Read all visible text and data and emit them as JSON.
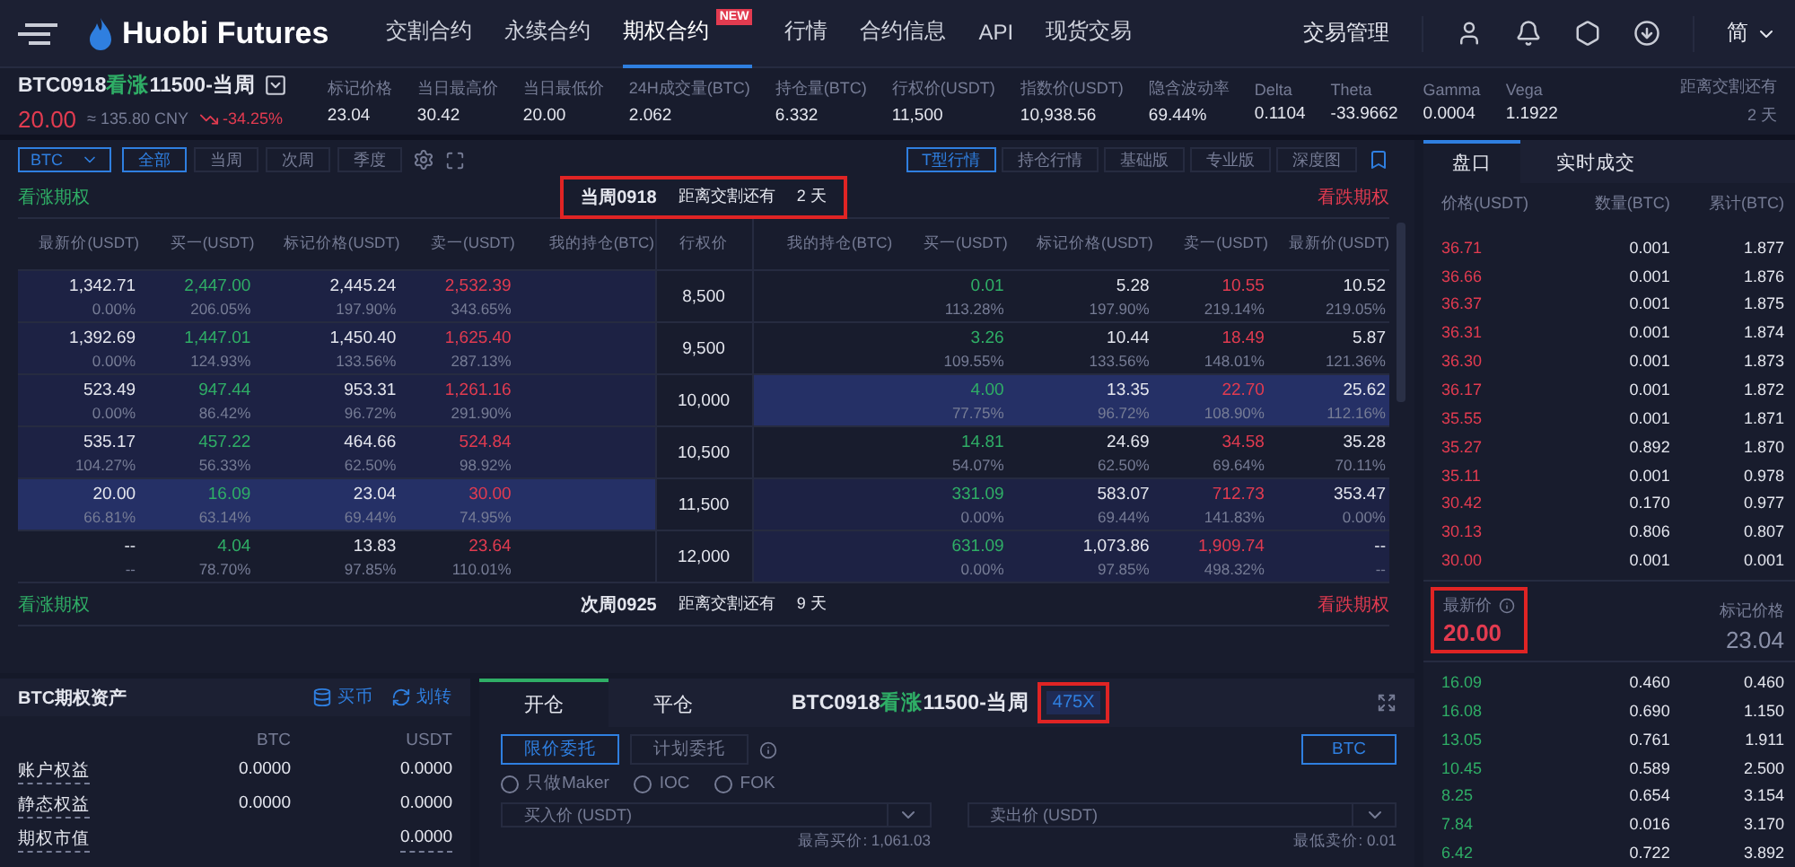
{
  "header": {
    "logo": "Huobi Futures",
    "nav": [
      {
        "label": "交割合约",
        "selected": false
      },
      {
        "label": "永续合约",
        "selected": false
      },
      {
        "label": "期权合约",
        "selected": true,
        "badge": "NEW"
      },
      {
        "label": "行情",
        "selected": false
      },
      {
        "label": "合约信息",
        "selected": false
      },
      {
        "label": "API",
        "selected": false
      },
      {
        "label": "现货交易",
        "selected": false
      }
    ],
    "manage": "交易管理",
    "language": "简"
  },
  "ticker": {
    "contract": {
      "code": "BTC0918",
      "side": "看涨",
      "detail": "11500-当周"
    },
    "price": "20.00",
    "cny": "≈ 135.80 CNY",
    "change": "-34.25%",
    "stats": [
      {
        "label": "标记价格",
        "value": "23.04"
      },
      {
        "label": "当日最高价",
        "value": "30.42"
      },
      {
        "label": "当日最低价",
        "value": "20.00"
      },
      {
        "label": "24H成交量(BTC)",
        "value": "2.062"
      },
      {
        "label": "持仓量(BTC)",
        "value": "6.332"
      },
      {
        "label": "行权价(USDT)",
        "value": "11,500"
      },
      {
        "label": "指数价(USDT)",
        "value": "10,938.56"
      },
      {
        "label": "隐含波动率",
        "value": "69.44%"
      },
      {
        "label": "Delta",
        "value": "0.1104"
      },
      {
        "label": "Theta",
        "value": "-33.9662"
      },
      {
        "label": "Gamma",
        "value": "0.0004"
      },
      {
        "label": "Vega",
        "value": "1.1922"
      }
    ],
    "delivery_label": "距离交割还有",
    "delivery_value": "2 天"
  },
  "toolbar": {
    "asset": "BTC",
    "periods": [
      {
        "label": "全部",
        "selected": true
      },
      {
        "label": "当周",
        "selected": false
      },
      {
        "label": "次周",
        "selected": false
      },
      {
        "label": "季度",
        "selected": false
      }
    ],
    "views": [
      {
        "label": "T型行情",
        "selected": true
      },
      {
        "label": "持仓行情",
        "selected": false
      },
      {
        "label": "基础版",
        "selected": false
      },
      {
        "label": "专业版",
        "selected": false
      },
      {
        "label": "深度图",
        "selected": false
      }
    ]
  },
  "sections": [
    {
      "call_title": "看涨期权",
      "put_title": "看跌期权",
      "expiry": "当周0918",
      "countdown_label": "距离交割还有",
      "countdown_value": "2 天",
      "highlighted": true,
      "columns": [
        "最新价(USDT)",
        "买一(USDT)",
        "标记价格(USDT)",
        "卖一(USDT)",
        "我的持仓(BTC)",
        "行权价",
        "我的持仓(BTC)",
        "买一(USDT)",
        "标记价格(USDT)",
        "卖一(USDT)",
        "最新价(USDT)"
      ],
      "rows": [
        {
          "strike": "8,500",
          "call": {
            "last": "1,342.71",
            "last_pct": "0.00%",
            "bid": "2,447.00",
            "bid_pct": "206.05%",
            "mark": "2,445.24",
            "mark_pct": "197.90%",
            "ask": "2,532.39",
            "ask_pct": "343.65%",
            "in_the_money": true,
            "selected": false
          },
          "put": {
            "last": "10.52",
            "last_pct": "219.05%",
            "bid": "0.01",
            "bid_pct": "113.28%",
            "mark": "5.28",
            "mark_pct": "197.90%",
            "ask": "10.55",
            "ask_pct": "219.14%",
            "in_the_money": false,
            "selected": false
          }
        },
        {
          "strike": "9,500",
          "call": {
            "last": "1,392.69",
            "last_pct": "0.00%",
            "bid": "1,447.01",
            "bid_pct": "124.93%",
            "mark": "1,450.40",
            "mark_pct": "133.56%",
            "ask": "1,625.40",
            "ask_pct": "287.13%",
            "in_the_money": true,
            "selected": false
          },
          "put": {
            "last": "5.87",
            "last_pct": "121.36%",
            "bid": "3.26",
            "bid_pct": "109.55%",
            "mark": "10.44",
            "mark_pct": "133.56%",
            "ask": "18.49",
            "ask_pct": "148.01%",
            "in_the_money": false,
            "selected": false
          }
        },
        {
          "strike": "10,000",
          "call": {
            "last": "523.49",
            "last_pct": "0.00%",
            "bid": "947.44",
            "bid_pct": "86.42%",
            "mark": "953.31",
            "mark_pct": "96.72%",
            "ask": "1,261.16",
            "ask_pct": "291.90%",
            "in_the_money": true,
            "selected": false
          },
          "put": {
            "last": "25.62",
            "last_pct": "112.16%",
            "bid": "4.00",
            "bid_pct": "77.75%",
            "mark": "13.35",
            "mark_pct": "96.72%",
            "ask": "22.70",
            "ask_pct": "108.90%",
            "in_the_money": false,
            "selected": true
          }
        },
        {
          "strike": "10,500",
          "call": {
            "last": "535.17",
            "last_pct": "104.27%",
            "bid": "457.22",
            "bid_pct": "56.33%",
            "mark": "464.66",
            "mark_pct": "62.50%",
            "ask": "524.84",
            "ask_pct": "98.92%",
            "in_the_money": true,
            "selected": false
          },
          "put": {
            "last": "35.28",
            "last_pct": "70.11%",
            "bid": "14.81",
            "bid_pct": "54.07%",
            "mark": "24.69",
            "mark_pct": "62.50%",
            "ask": "34.58",
            "ask_pct": "69.64%",
            "in_the_money": false,
            "selected": false
          }
        },
        {
          "strike": "11,500",
          "call": {
            "last": "20.00",
            "last_pct": "66.81%",
            "bid": "16.09",
            "bid_pct": "63.14%",
            "mark": "23.04",
            "mark_pct": "69.44%",
            "ask": "30.00",
            "ask_pct": "74.95%",
            "in_the_money": false,
            "selected": true
          },
          "put": {
            "last": "353.47",
            "last_pct": "0.00%",
            "bid": "331.09",
            "bid_pct": "0.00%",
            "mark": "583.07",
            "mark_pct": "69.44%",
            "ask": "712.73",
            "ask_pct": "141.83%",
            "in_the_money": true,
            "selected": false
          }
        },
        {
          "strike": "12,000",
          "call": {
            "last": "--",
            "last_pct": "--",
            "bid": "4.04",
            "bid_pct": "78.70%",
            "mark": "13.83",
            "mark_pct": "97.85%",
            "ask": "23.64",
            "ask_pct": "110.01%",
            "in_the_money": false,
            "selected": false
          },
          "put": {
            "last": "--",
            "last_pct": "--",
            "bid": "631.09",
            "bid_pct": "0.00%",
            "mark": "1,073.86",
            "mark_pct": "97.85%",
            "ask": "1,909.74",
            "ask_pct": "498.32%",
            "in_the_money": true,
            "selected": false
          }
        }
      ]
    },
    {
      "call_title": "看涨期权",
      "put_title": "看跌期权",
      "expiry": "次周0925",
      "countdown_label": "距离交割还有",
      "countdown_value": "9 天",
      "highlighted": false
    }
  ],
  "assets": {
    "title": "BTC期权资产",
    "actions": [
      "买币",
      "划转"
    ],
    "columns": [
      "BTC",
      "USDT"
    ],
    "rows": [
      {
        "label": "账户权益",
        "btc": "0.0000",
        "usdt": "0.0000"
      },
      {
        "label": "静态权益",
        "btc": "0.0000",
        "usdt": "0.0000"
      },
      {
        "label": "期权市值",
        "usdt": "0.0000"
      }
    ]
  },
  "order": {
    "tabs": [
      {
        "label": "开仓",
        "selected": true
      },
      {
        "label": "平仓",
        "selected": false
      }
    ],
    "contract": {
      "code": "BTC0918",
      "side": "看涨",
      "detail": "11500-当周"
    },
    "leverage": "475X",
    "leverage_highlighted": true,
    "types": [
      {
        "label": "限价委托",
        "selected": true
      },
      {
        "label": "计划委托",
        "selected": false
      }
    ],
    "unit": "BTC",
    "options": [
      {
        "label": "只做Maker",
        "checked": false
      },
      {
        "label": "IOC",
        "checked": false
      },
      {
        "label": "FOK",
        "checked": false
      }
    ],
    "buy_placeholder": "买入价 (USDT)",
    "sell_placeholder": "卖出价 (USDT)",
    "buy_hint": "最高买价: 1,061.03",
    "sell_hint": "最低卖价: 0.01"
  },
  "orderbook": {
    "tabs": [
      {
        "label": "盘口",
        "selected": true
      },
      {
        "label": "实时成交",
        "selected": false
      }
    ],
    "columns": [
      "价格(USDT)",
      "数量(BTC)",
      "累计(BTC)"
    ],
    "asks": [
      [
        "36.71",
        "0.001",
        "1.877"
      ],
      [
        "36.66",
        "0.001",
        "1.876"
      ],
      [
        "36.37",
        "0.001",
        "1.875"
      ],
      [
        "36.31",
        "0.001",
        "1.874"
      ],
      [
        "36.30",
        "0.001",
        "1.873"
      ],
      [
        "36.17",
        "0.001",
        "1.872"
      ],
      [
        "35.55",
        "0.001",
        "1.871"
      ],
      [
        "35.27",
        "0.892",
        "1.870"
      ],
      [
        "35.11",
        "0.001",
        "0.978"
      ],
      [
        "30.42",
        "0.170",
        "0.977"
      ],
      [
        "30.13",
        "0.806",
        "0.807"
      ],
      [
        "30.00",
        "0.001",
        "0.001"
      ]
    ],
    "last_label": "最新价",
    "last_price": "20.00",
    "last_highlighted": true,
    "mark_label": "标记价格",
    "mark_price": "23.04",
    "bids": [
      [
        "16.09",
        "0.460",
        "0.460"
      ],
      [
        "16.08",
        "0.690",
        "1.150"
      ],
      [
        "13.05",
        "0.761",
        "1.911"
      ],
      [
        "10.45",
        "0.589",
        "2.500"
      ],
      [
        "8.25",
        "0.654",
        "3.154"
      ],
      [
        "7.84",
        "0.016",
        "3.170"
      ],
      [
        "6.42",
        "0.722",
        "3.892"
      ]
    ]
  }
}
